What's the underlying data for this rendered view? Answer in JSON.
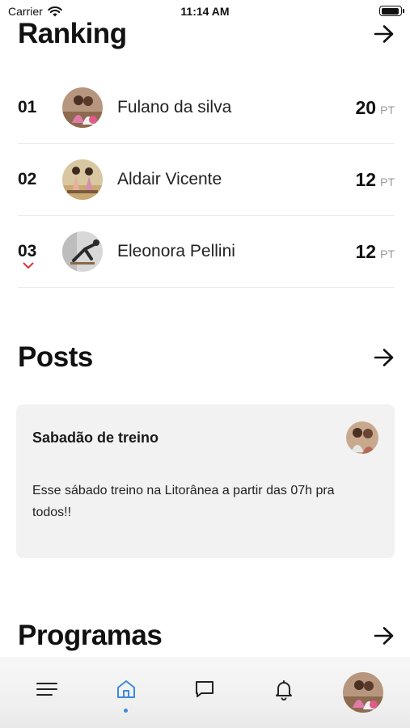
{
  "status_bar": {
    "carrier": "Carrier",
    "time": "11:14 AM",
    "battery_level": 0.95
  },
  "ranking": {
    "title": "Ranking",
    "items": [
      {
        "position": "01",
        "name": "Fulano da silva",
        "points": "20",
        "unit": "PT",
        "avatar": "user-photo"
      },
      {
        "position": "02",
        "name": "Aldair Vicente",
        "points": "12",
        "unit": "PT",
        "avatar": "user-photo"
      },
      {
        "position": "03",
        "name": "Eleonora Pellini",
        "points": "12",
        "unit": "PT",
        "avatar": "user-photo",
        "trend": "down"
      }
    ]
  },
  "posts": {
    "title": "Posts",
    "items": [
      {
        "title": "Sabadão de treino",
        "body": "Esse sábado treino na Litorânea a partir das 07h pra todos!!",
        "avatar": "user-photo"
      }
    ]
  },
  "programs": {
    "title": "Programas"
  },
  "tab_bar": {
    "items": [
      "menu-icon",
      "home-icon",
      "chat-icon",
      "bell-icon",
      "profile-avatar"
    ],
    "active": "home-icon"
  },
  "colors": {
    "accent": "#3d8bdb",
    "trend_down": "#d9383c",
    "card_bg": "#f2f2f2",
    "muted": "#999999"
  }
}
